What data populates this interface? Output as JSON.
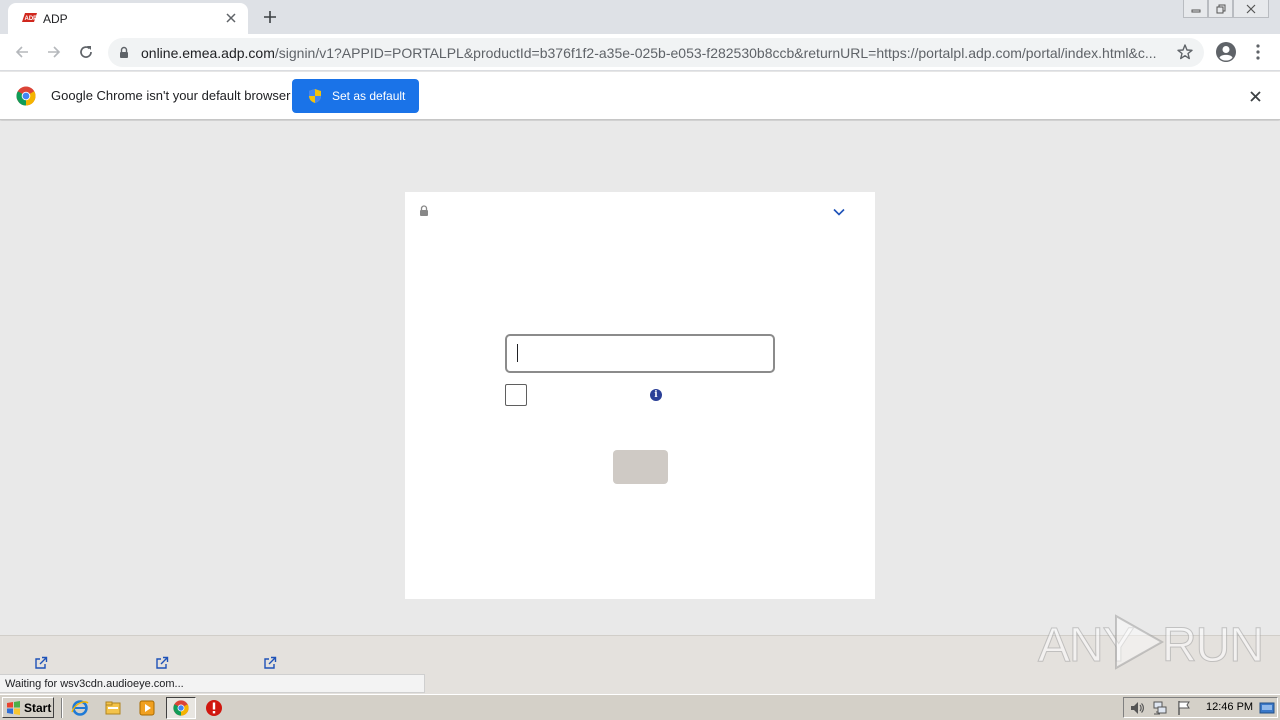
{
  "browser": {
    "tab": {
      "title": "ADP",
      "favicon": "adp-logo-icon"
    },
    "address": {
      "host": "online.emea.adp.com",
      "path": "/signin/v1?APPID=PORTALPL&productId=b376f1f2-a35e-025b-e053-f282530b8ccb&returnURL=https://portalpl.adp.com/portal/index.html&c..."
    }
  },
  "infobar": {
    "message": "Google Chrome isn't your default browser",
    "button_label": "Set as default"
  },
  "login": {
    "user_id_value": "",
    "remember_checked": false
  },
  "status": {
    "text": "Waiting for wsv3cdn.audioeye.com..."
  },
  "watermark": {
    "left": "ANY",
    "right": "RUN"
  },
  "taskbar": {
    "start_label": "Start",
    "clock": "12:46 PM"
  },
  "colors": {
    "accent": "#1a73e8",
    "adp_red": "#d0271d",
    "info_blue": "#2a3f97",
    "button_disabled": "#cfcac5"
  }
}
